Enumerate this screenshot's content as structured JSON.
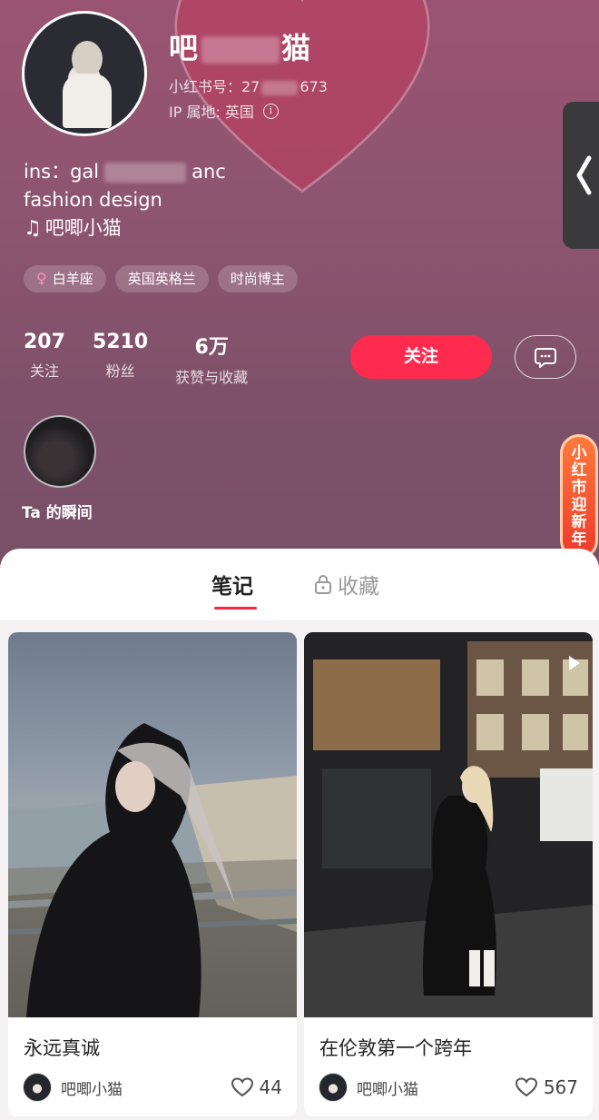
{
  "profile": {
    "nickname_start": "吧",
    "nickname_end": "猫",
    "xhs_id_label": "小红书号：27",
    "xhs_id_tail": "673",
    "ip_location": "IP 属地: 英国",
    "bio_ins_prefix": "ins：gal",
    "bio_ins_suffix": "anc",
    "bio_line2": "fashion design",
    "bio_line3": "吧唧小猫",
    "tags": [
      "白羊座",
      "英国英格兰",
      "时尚博主"
    ],
    "stats": [
      {
        "value": "207",
        "label": "关注"
      },
      {
        "value": "5210",
        "label": "粉丝"
      },
      {
        "value": "6万",
        "label": "获赞与收藏"
      }
    ],
    "follow_label": "关注",
    "moment_label": "Ta 的瞬间",
    "promo_chars": [
      "小",
      "红",
      "市",
      "迎",
      "新",
      "年"
    ]
  },
  "tabs": {
    "notes": "笔记",
    "collect": "收藏"
  },
  "notes": [
    {
      "title": "永远真诚",
      "author": "吧唧小猫",
      "likes": "44",
      "is_video": false
    },
    {
      "title": "在伦敦第一个跨年",
      "author": "吧唧小猫",
      "likes": "567",
      "is_video": true
    }
  ],
  "colors": {
    "accent": "#ff2442",
    "follow_button": "#ff2b4f"
  }
}
